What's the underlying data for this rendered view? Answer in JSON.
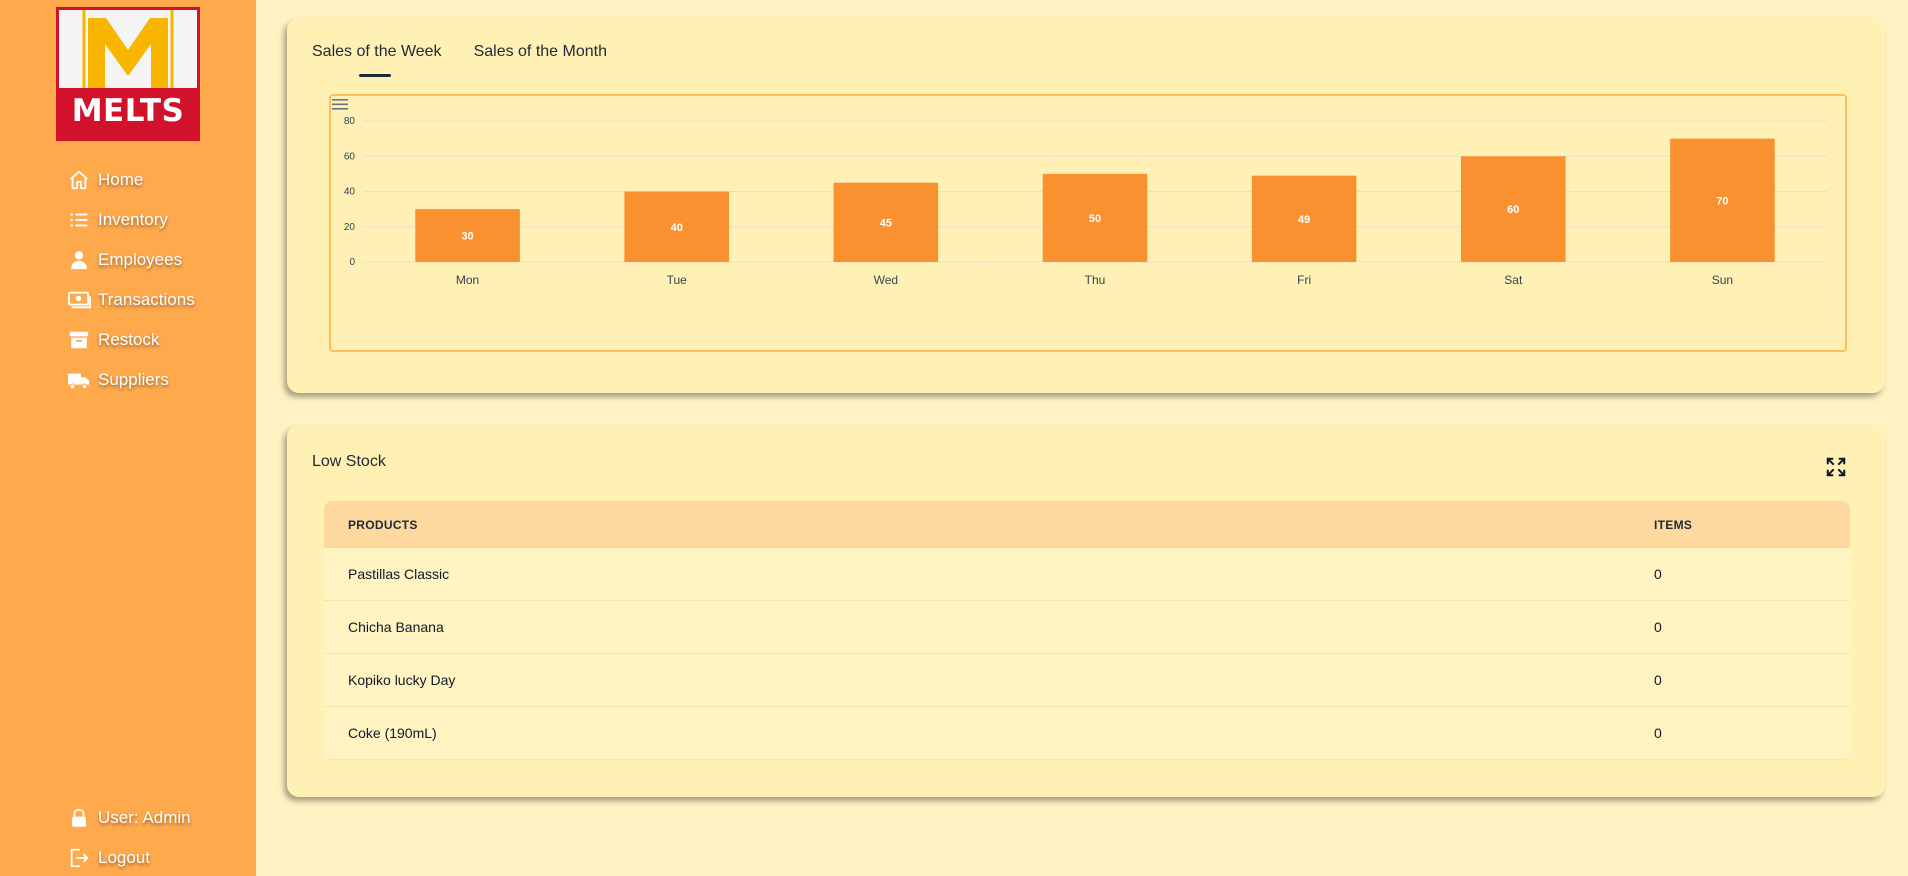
{
  "brand": {
    "logo_text": "MELTS",
    "logo_letter": "M",
    "colors": {
      "sidebar": "#ffa94d",
      "logo_red": "#d2112a",
      "logo_yellow": "#f7b500",
      "bar": "#f99131",
      "background": "#fff3c4"
    }
  },
  "sidebar": {
    "items": [
      {
        "label": "Home",
        "icon": "home-icon"
      },
      {
        "label": "Inventory",
        "icon": "list-icon"
      },
      {
        "label": "Employees",
        "icon": "user-icon"
      },
      {
        "label": "Transactions",
        "icon": "money-icon"
      },
      {
        "label": "Restock",
        "icon": "archive-icon"
      },
      {
        "label": "Suppliers",
        "icon": "truck-icon"
      }
    ],
    "user_label": "User: Admin",
    "logout_label": "Logout"
  },
  "sales": {
    "tabs": [
      {
        "label": "Sales of the Week",
        "active": true
      },
      {
        "label": "Sales of the Month",
        "active": false
      }
    ]
  },
  "chart_data": {
    "type": "bar",
    "categories": [
      "Mon",
      "Tue",
      "Wed",
      "Thu",
      "Fri",
      "Sat",
      "Sun"
    ],
    "values": [
      30,
      40,
      45,
      50,
      49,
      60,
      70
    ],
    "yticks": [
      0,
      20,
      40,
      60,
      80
    ],
    "ylim": [
      0,
      80
    ],
    "grid": true,
    "data_labels": true,
    "color": "#f99131"
  },
  "low_stock": {
    "title": "Low Stock",
    "columns": [
      "PRODUCTS",
      "ITEMS"
    ],
    "rows": [
      {
        "product": "Pastillas Classic",
        "items": "0"
      },
      {
        "product": "Chicha Banana",
        "items": "0"
      },
      {
        "product": "Kopiko lucky Day",
        "items": "0"
      },
      {
        "product": "Coke (190mL)",
        "items": "0"
      }
    ]
  }
}
